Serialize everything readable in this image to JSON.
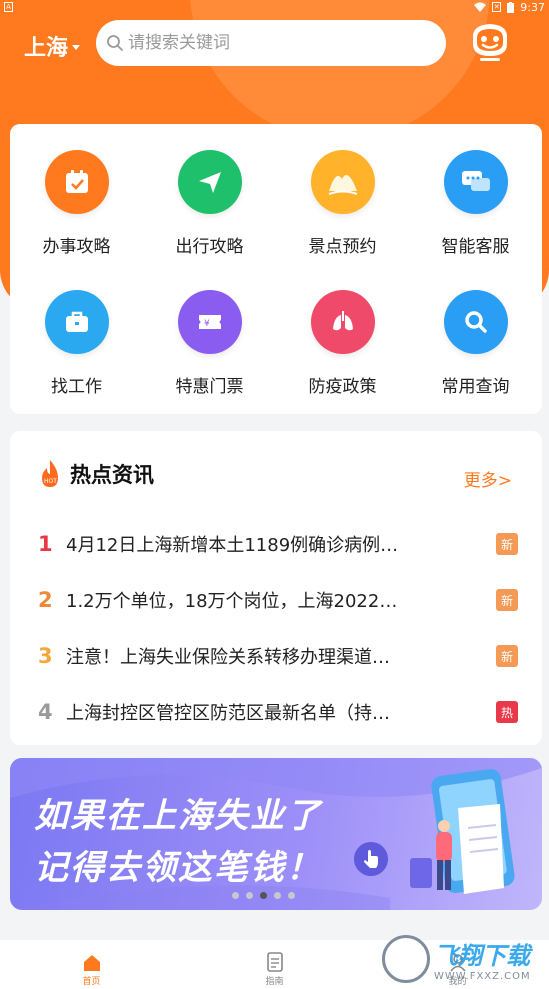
{
  "status_bar": {
    "time": "9:37",
    "left_icon": "A"
  },
  "header": {
    "city": "上海",
    "search_placeholder": "请搜索关键词"
  },
  "services": [
    {
      "label": "办事攻略",
      "icon": "calendar-icon",
      "color": "#ff7a1f"
    },
    {
      "label": "出行攻略",
      "icon": "paper-plane-icon",
      "color": "#1fc06b"
    },
    {
      "label": "景点预约",
      "icon": "mountain-icon",
      "color": "#ffb22a"
    },
    {
      "label": "智能客服",
      "icon": "chat-icon",
      "color": "#2a9df4"
    },
    {
      "label": "找工作",
      "icon": "briefcase-icon",
      "color": "#2aa8f0"
    },
    {
      "label": "特惠门票",
      "icon": "ticket-icon",
      "color": "#8b5cf0"
    },
    {
      "label": "防疫政策",
      "icon": "lungs-icon",
      "color": "#f04a6a"
    },
    {
      "label": "常用查询",
      "icon": "search-icon",
      "color": "#2a9df4"
    }
  ],
  "news": {
    "title": "热点资讯",
    "more": "更多>",
    "items": [
      {
        "num": "1",
        "text": "4月12日上海新增本土1189例确诊病例…",
        "tag": "新",
        "num_color": "#e8384a",
        "tag_color": "#f59a56"
      },
      {
        "num": "2",
        "text": "1.2万个单位，18万个岗位，上海2022…",
        "tag": "新",
        "num_color": "#f0883a",
        "tag_color": "#f59a56"
      },
      {
        "num": "3",
        "text": "注意！上海失业保险关系转移办理渠道…",
        "tag": "新",
        "num_color": "#f5a83a",
        "tag_color": "#f59a56"
      },
      {
        "num": "4",
        "text": "上海封控区管控区防范区最新名单（持…",
        "tag": "热",
        "num_color": "#9a9a9a",
        "tag_color": "#e8384a"
      }
    ]
  },
  "banner": {
    "line1": "如果在上海失业了",
    "line2": "记得去领这笔钱！",
    "dots": 5,
    "active_dot": 2
  },
  "bottom_nav": [
    {
      "label": "首页",
      "icon": "home-icon",
      "active": true
    },
    {
      "label": "指南",
      "icon": "document-icon",
      "active": false
    },
    {
      "label": "我的",
      "icon": "user-icon",
      "active": false
    }
  ],
  "watermark": {
    "title": "飞翔下载",
    "url": "WWW.FXXZ.COM"
  }
}
